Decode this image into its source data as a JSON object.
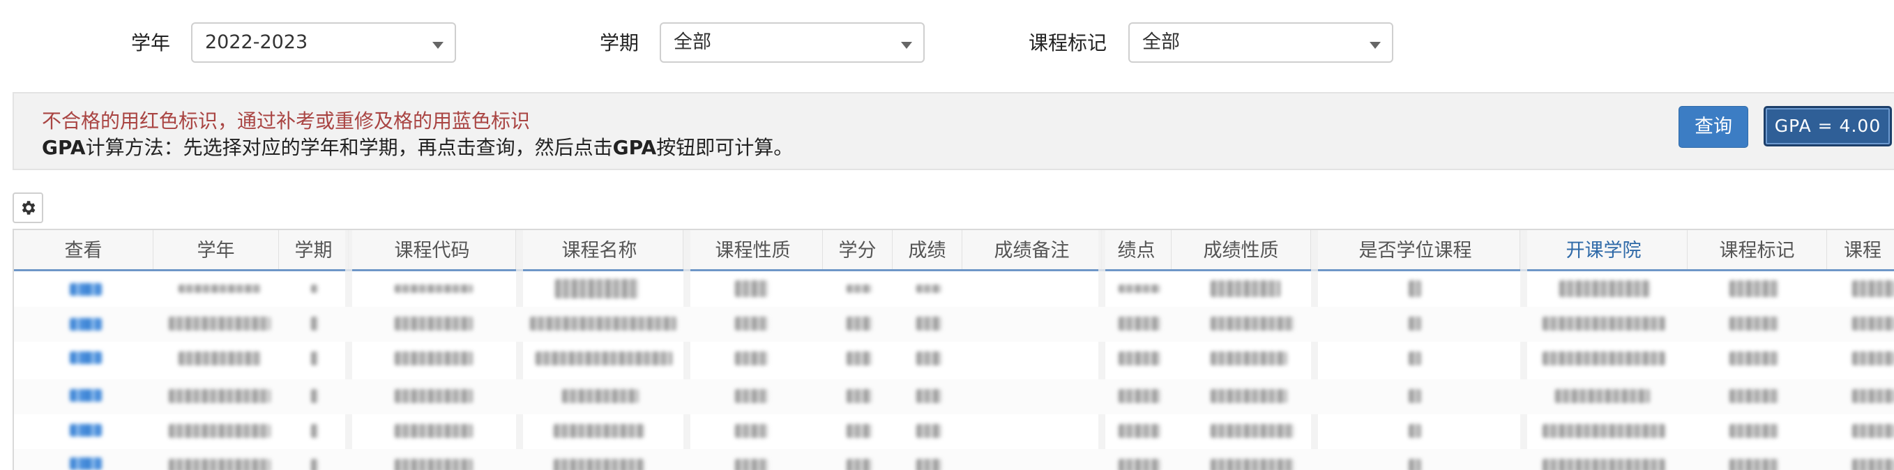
{
  "filters": [
    {
      "label": "学年",
      "value": "2022-2023"
    },
    {
      "label": "学期",
      "value": "全部"
    },
    {
      "label": "课程标记",
      "value": "全部"
    }
  ],
  "notice": {
    "red_text": "不合格的用红色标识，通过补考或重修及格的用蓝色标识",
    "gpa_prefix": "GPA",
    "gpa_text_mid": "计算方法：先选择对应的学年和学期，再点击查询，然后点击",
    "gpa_word": "GPA",
    "gpa_suffix": "按钮即可计算。"
  },
  "buttons": {
    "query": "查询",
    "gpa": "GPA = 4.00"
  },
  "table": {
    "columns": [
      "查看",
      "学年",
      "学期",
      "课程代码",
      "课程名称",
      "课程性质",
      "学分",
      "成绩",
      "成绩备注",
      "绩点",
      "成绩性质",
      "是否学位课程",
      "开课学院",
      "课程标记",
      "课程"
    ],
    "sorted_column": "开课学院",
    "rows_visible": 6
  },
  "colors": {
    "accent": "#3c7dc4",
    "gpa_button": "#2f5f97",
    "failed_text": "#a94442"
  },
  "icons": [
    "chevron-down-icon",
    "gear-icon"
  ]
}
